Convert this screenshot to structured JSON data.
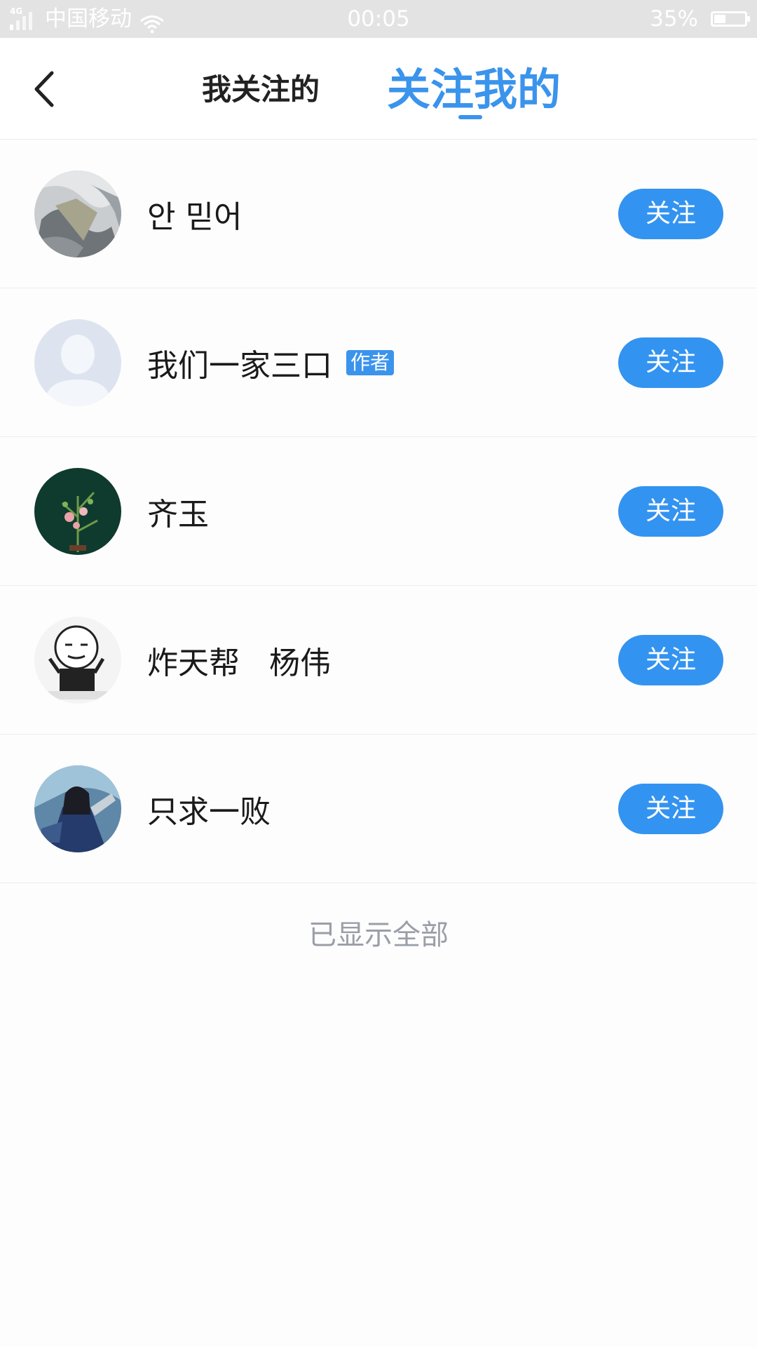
{
  "status_bar": {
    "network_type": "4G",
    "carrier": "中国移动",
    "time": "00:05",
    "battery_percent": "35%",
    "battery_level": 0.35,
    "wifi_icon": "wifi-icon",
    "signal_icon": "signal-icon"
  },
  "header": {
    "back_icon": "back-arrow-icon",
    "tabs": [
      {
        "label": "我关注的",
        "active": false
      },
      {
        "label": "关注我的",
        "active": true
      }
    ],
    "accent_color": "#3a94ec"
  },
  "followers": [
    {
      "name": "안 믿어",
      "badge": "",
      "follow_label": "关注"
    },
    {
      "name": "我们一家三口",
      "badge": "作者",
      "follow_label": "关注"
    },
    {
      "name": "齐玉",
      "badge": "",
      "follow_label": "关注"
    },
    {
      "name": "炸天帮   杨伟",
      "badge": "",
      "follow_label": "关注"
    },
    {
      "name": "只求一败",
      "badge": "",
      "follow_label": "关注"
    }
  ],
  "footer": {
    "end_text": "已显示全部"
  },
  "colors": {
    "button": "#3393f0",
    "badge": "#3a94ec",
    "footer_text": "#9a9ea8"
  }
}
